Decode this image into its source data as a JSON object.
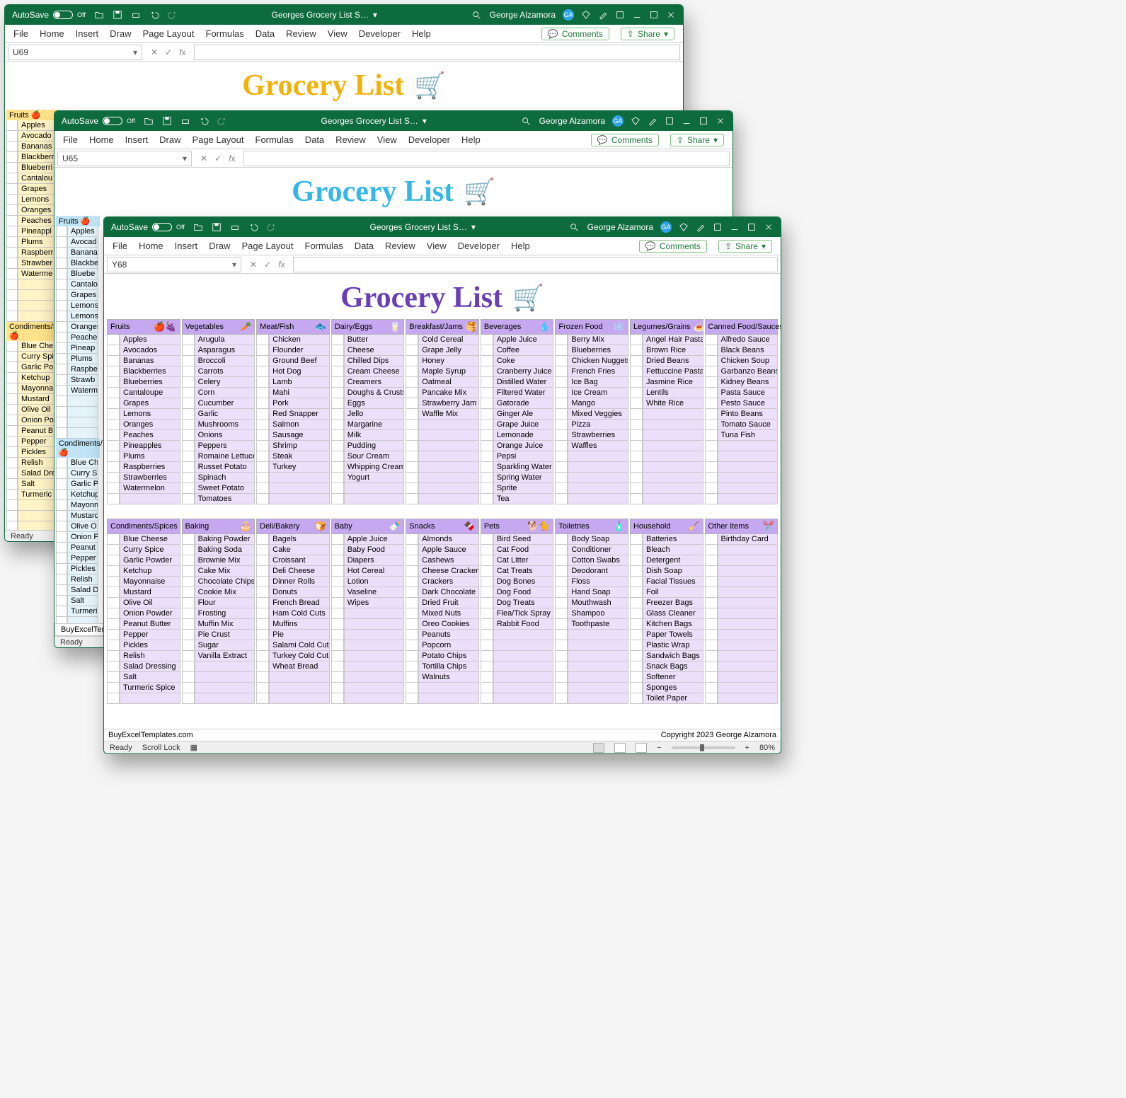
{
  "common": {
    "autosave_label": "AutoSave",
    "autosave_state": "Off",
    "doc_title": "Georges Grocery List S…",
    "user_name": "George Alzamora",
    "user_initials": "GA",
    "big_title": "Grocery List",
    "ribbon": {
      "file": "File",
      "home": "Home",
      "insert": "Insert",
      "draw": "Draw",
      "page_layout": "Page Layout",
      "formulas": "Formulas",
      "data": "Data",
      "review": "Review",
      "view": "View",
      "developer": "Developer",
      "help": "Help",
      "comments": "Comments",
      "share": "Share"
    },
    "status": {
      "ready": "Ready",
      "scroll_lock": "Scroll Lock"
    }
  },
  "win1": {
    "namebox": "U69"
  },
  "win2": {
    "namebox": "U65"
  },
  "win3": {
    "namebox": "Y68",
    "footer_left": "BuyExcelTemplates.com",
    "footer_right": "Copyright 2023 George Alzamora",
    "zoom": "80%"
  },
  "categories_top": [
    {
      "name": "Fruits",
      "icon": "🍎🍇",
      "items": [
        "Apples",
        "Avocados",
        "Bananas",
        "Blackberries",
        "Blueberries",
        "Cantaloupe",
        "Grapes",
        "Lemons",
        "Oranges",
        "Peaches",
        "Pineapples",
        "Plums",
        "Raspberries",
        "Strawberries",
        "Watermelon"
      ]
    },
    {
      "name": "Vegetables",
      "icon": "🥕",
      "items": [
        "Arugula",
        "Asparagus",
        "Broccoli",
        "Carrots",
        "Celery",
        "Corn",
        "Cucumber",
        "Garlic",
        "Mushrooms",
        "Onions",
        "Peppers",
        "Romaine Lettuce",
        "Russet Potato",
        "Spinach",
        "Sweet Potato",
        "Tomatoes"
      ]
    },
    {
      "name": "Meat/Fish",
      "icon": "🐟",
      "items": [
        "Chicken",
        "Flounder",
        "Ground Beef",
        "Hot Dog",
        "Lamb",
        "Mahi",
        "Pork",
        "Red Snapper",
        "Salmon",
        "Sausage",
        "Shrimp",
        "Steak",
        "Turkey"
      ]
    },
    {
      "name": "Dairy/Eggs",
      "icon": "🥛",
      "items": [
        "Butter",
        "Cheese",
        "Chilled Dips",
        "Cream Cheese",
        "Creamers",
        "Doughs & Crusts",
        "Eggs",
        "Jello",
        "Margarine",
        "Milk",
        "Pudding",
        "Sour Cream",
        "Whipping Cream",
        "Yogurt"
      ]
    },
    {
      "name": "Breakfast/Jams",
      "icon": "🥞",
      "items": [
        "Cold Cereal",
        "Grape Jelly",
        "Honey",
        "Maple Syrup",
        "Oatmeal",
        "Pancake Mix",
        "Strawberry Jam",
        "Waffle Mix"
      ]
    },
    {
      "name": "Beverages",
      "icon": "💧",
      "items": [
        "Apple Juice",
        "Coffee",
        "Coke",
        "Cranberry Juice",
        "Distilled Water",
        "Filtered Water",
        "Gatorade",
        "Ginger Ale",
        "Grape Juice",
        "Lemonade",
        "Orange Juice",
        "Pepsi",
        "Sparkling Water",
        "Spring Water",
        "Sprite",
        "Tea"
      ]
    },
    {
      "name": "Frozen Food",
      "icon": "❄️",
      "items": [
        "Berry Mix",
        "Blueberries",
        "Chicken Nuggets",
        "French Fries",
        "Ice Bag",
        "Ice Cream",
        "Mango",
        "Mixed Veggies",
        "Pizza",
        "Strawberries",
        "Waffles"
      ]
    },
    {
      "name": "Legumes/Grains",
      "icon": "🍝",
      "items": [
        "Angel Hair Pasta",
        "Brown Rice",
        "Dried Beans",
        "Fettuccine Pasta",
        "Jasmine Rice",
        "Lentils",
        "White Rice"
      ]
    },
    {
      "name": "Canned Food/Sauces",
      "icon": "🥫",
      "items": [
        "Alfredo Sauce",
        "Black Beans",
        "Chicken Soup",
        "Garbanzo Beans",
        "Kidney Beans",
        "Pasta Sauce",
        "Pesto Sauce",
        "Pinto Beans",
        "Tomato Sauce",
        "Tuna Fish"
      ]
    }
  ],
  "categories_bottom": [
    {
      "name": "Condiments/Spices",
      "icon": "🧂",
      "items": [
        "Blue Cheese",
        "Curry Spice",
        "Garlic Powder",
        "Ketchup",
        "Mayonnaise",
        "Mustard",
        "Olive Oil",
        "Onion Powder",
        "Peanut Butter",
        "Pepper",
        "Pickles",
        "Relish",
        "Salad Dressing",
        "Salt",
        "Turmeric Spice"
      ]
    },
    {
      "name": "Baking",
      "icon": "🎂",
      "items": [
        "Baking Powder",
        "Baking Soda",
        "Brownie Mix",
        "Cake Mix",
        "Chocolate Chips",
        "Cookie Mix",
        "Flour",
        "Frosting",
        "Muffin Mix",
        "Pie Crust",
        "Sugar",
        "Vanilla Extract"
      ]
    },
    {
      "name": "Deli/Bakery",
      "icon": "🍞",
      "items": [
        "Bagels",
        "Cake",
        "Croissant",
        "Deli Cheese",
        "Dinner Rolls",
        "Donuts",
        "French Bread",
        "Ham Cold Cuts",
        "Muffins",
        "Pie",
        "Salami Cold Cuts",
        "Turkey Cold Cuts",
        "Wheat Bread"
      ]
    },
    {
      "name": "Baby",
      "icon": "🍼",
      "items": [
        "Apple Juice",
        "Baby Food",
        "Diapers",
        "Hot Cereal",
        "Lotion",
        "Vaseline",
        "Wipes"
      ]
    },
    {
      "name": "Snacks",
      "icon": "🍫",
      "items": [
        "Almonds",
        "Apple Sauce",
        "Cashews",
        "Cheese Crackers",
        "Crackers",
        "Dark Chocolate",
        "Dried Fruit",
        "Mixed Nuts",
        "Oreo Cookies",
        "Peanuts",
        "Popcorn",
        "Potato Chips",
        "Tortilla Chips",
        "Walnuts"
      ]
    },
    {
      "name": "Pets",
      "icon": "🐕🐈",
      "items": [
        "Bird Seed",
        "Cat Food",
        "Cat Litter",
        "Cat Treats",
        "Dog Bones",
        "Dog Food",
        "Dog Treats",
        "Flea/Tick Spray",
        "Rabbit Food"
      ]
    },
    {
      "name": "Toiletries",
      "icon": "🧴",
      "items": [
        "Body Soap",
        "Conditioner",
        "Cotton Swabs",
        "Deodorant",
        "Floss",
        "Hand Soap",
        "Mouthwash",
        "Shampoo",
        "Toothpaste"
      ]
    },
    {
      "name": "Household",
      "icon": "🧹",
      "items": [
        "Batteries",
        "Bleach",
        "Detergent",
        "Dish Soap",
        "Facial Tissues",
        "Foil",
        "Freezer Bags",
        "Glass Cleaner",
        "Kitchen Bags",
        "Paper Towels",
        "Plastic Wrap",
        "Sandwich Bags",
        "Snack Bags",
        "Softener",
        "Sponges",
        "Toilet Paper"
      ]
    },
    {
      "name": "Other Items",
      "icon": "✂️",
      "items": [
        "Birthday Card"
      ]
    }
  ],
  "bg_yellow": {
    "fruits_head": "Fruits",
    "fruits": [
      "Apples",
      "Avocado",
      "Bananas",
      "Blackberr",
      "Blueberri",
      "Cantalou",
      "Grapes",
      "Lemons",
      "Oranges",
      "Peaches",
      "Pineappl",
      "Plums",
      "Raspberr",
      "Strawber",
      "Waterme"
    ],
    "cond_head": "Condiments/S",
    "cond": [
      "Blue Che",
      "Curry Spi",
      "Garlic Po",
      "Ketchup",
      "Mayonna",
      "Mustard",
      "Olive Oil",
      "Onion Po",
      "Peanut B",
      "Pepper",
      "Pickles",
      "Relish",
      "Salad Dre",
      "Salt",
      "Turmeric"
    ]
  },
  "bg_blue": {
    "fruits_head": "Fruits",
    "fruits": [
      "Apples",
      "Avocad",
      "Banana",
      "Blackbe",
      "Bluebe",
      "Cantalo",
      "Grapes",
      "Lemons",
      "Lemons",
      "Oranges",
      "Peache",
      "Pineap",
      "Plums",
      "Raspbe",
      "Strawb",
      "Waterm"
    ],
    "cond_head": "Condiments/",
    "cond": [
      "Blue Ch",
      "Curry Sp",
      "Garlic P",
      "Ketchup",
      "Mayonn",
      "Mustard",
      "Olive O",
      "Onion P",
      "Peanut",
      "Pepper",
      "Pickles",
      "Relish",
      "Salad Dr",
      "Salt",
      "Turmeri"
    ]
  },
  "sheet_tab": "BuyExcelTemplat"
}
